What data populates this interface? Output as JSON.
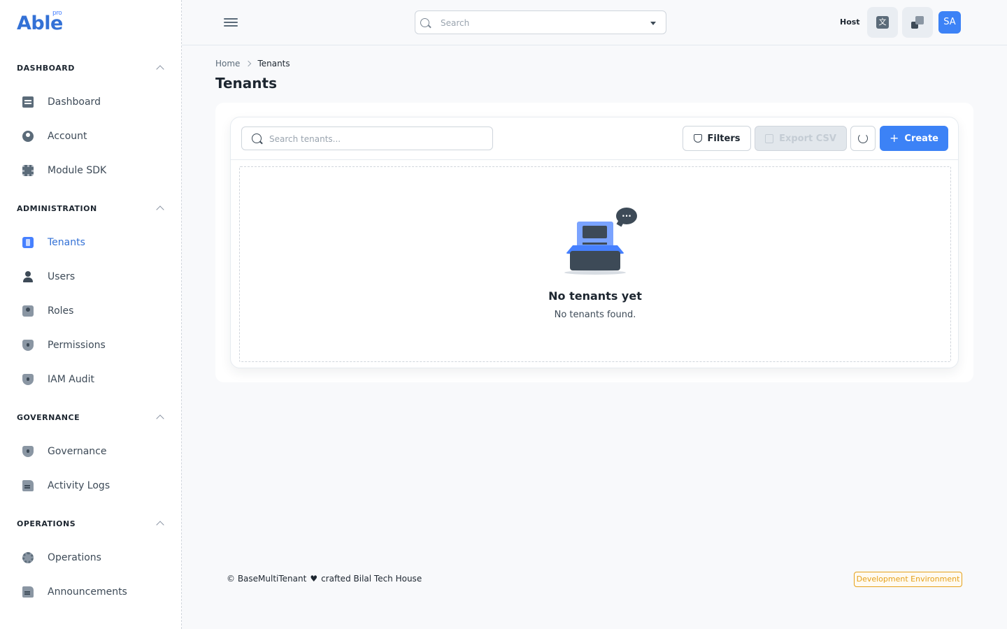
{
  "brand": {
    "logo": "Able",
    "badge": "pro"
  },
  "sidebar": {
    "sections": [
      {
        "title": "DASHBOARD",
        "items": [
          {
            "label": "Dashboard",
            "icon": "dashboard-icon"
          },
          {
            "label": "Account",
            "icon": "account-icon"
          },
          {
            "label": "Module SDK",
            "icon": "chip-icon"
          }
        ]
      },
      {
        "title": "ADMINISTRATION",
        "items": [
          {
            "label": "Tenants",
            "icon": "tenants-icon",
            "active": true
          },
          {
            "label": "Users",
            "icon": "user-icon"
          },
          {
            "label": "Roles",
            "icon": "roles-icon"
          },
          {
            "label": "Permissions",
            "icon": "shield-icon"
          },
          {
            "label": "IAM Audit",
            "icon": "shield-icon"
          }
        ]
      },
      {
        "title": "GOVERNANCE",
        "items": [
          {
            "label": "Governance",
            "icon": "shield-icon"
          },
          {
            "label": "Activity Logs",
            "icon": "file-icon"
          }
        ]
      },
      {
        "title": "OPERATIONS",
        "items": [
          {
            "label": "Operations",
            "icon": "gear-icon"
          },
          {
            "label": "Announcements",
            "icon": "file-icon"
          }
        ]
      }
    ]
  },
  "header": {
    "search_placeholder": "Search",
    "host_label": "Host",
    "lang_glyph": "文",
    "avatar_initials": "SA"
  },
  "breadcrumb": {
    "home": "Home",
    "current": "Tenants"
  },
  "page": {
    "title": "Tenants"
  },
  "toolbar": {
    "search_placeholder": "Search tenants...",
    "filters_label": "Filters",
    "export_label": "Export CSV",
    "create_label": "Create"
  },
  "empty_state": {
    "bubble_text": "...",
    "title": "No tenants yet",
    "subtitle": "No tenants found."
  },
  "footer": {
    "copyright": "© BaseMultiTenant",
    "heart": "♥",
    "crafted": "crafted Bilal Tech House",
    "env_badge": "Development Environment"
  },
  "colors": {
    "accent": "#3c82f6",
    "warning": "#e5a11a",
    "text": "#1d2630"
  }
}
